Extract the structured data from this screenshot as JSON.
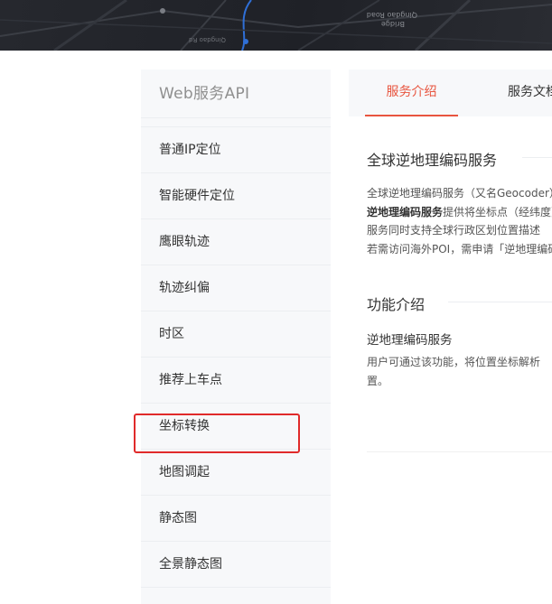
{
  "banner": {
    "map_labels": [
      "Qingdao Road",
      "Bridge",
      "Qingdao Rd"
    ]
  },
  "sidebar": {
    "title": "Web服务API",
    "items": [
      "普通IP定位",
      "智能硬件定位",
      "鹰眼轨迹",
      "轨迹纠偏",
      "时区",
      "推荐上车点",
      "坐标转换",
      "地图调起",
      "静态图",
      "全景静态图"
    ],
    "highlighted_item": "坐标转换"
  },
  "tabs": {
    "active": "服务介绍",
    "doc": "服务文档"
  },
  "content": {
    "section1_title": "全球逆地理编码服务",
    "section1_line1": "全球逆地理编码服务（又名Geocoder）",
    "section1_line2_bold": "逆地理编码服务",
    "section1_line2_rest": "提供将坐标点（经纬度）",
    "section1_line3": "服务同时支持全球行政区划位置描述",
    "section1_line4": "若需访问海外POI，需申请「逆地理编码",
    "section2_title": "功能介绍",
    "feature_title": "逆地理编码服务",
    "feature_line1": "用户可通过该功能，将位置坐标解析",
    "feature_line2": "置。"
  },
  "colors": {
    "accent": "#e8553f",
    "highlight_border": "#e02a2a",
    "sidebar_bg": "#f7f8fa"
  }
}
